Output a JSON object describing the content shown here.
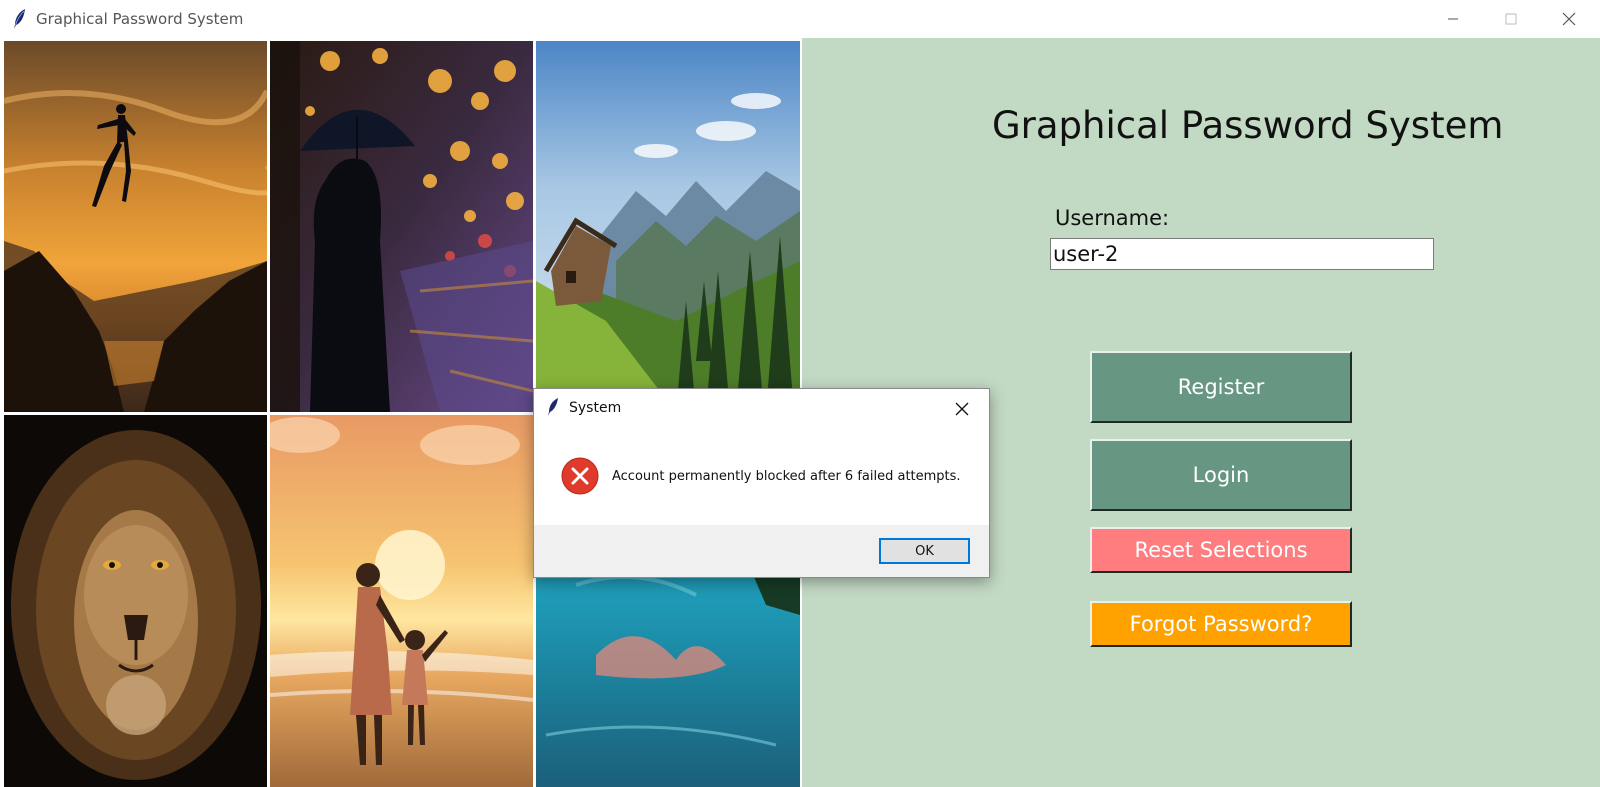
{
  "window": {
    "title": "Graphical Password System",
    "controls": [
      "minimize",
      "maximize",
      "close"
    ]
  },
  "image_grid": {
    "tiles": [
      {
        "subject": "person leaping over cliffs at sunset"
      },
      {
        "subject": "person with umbrella on rainy city street at night"
      },
      {
        "subject": "mountain cabin in alpine valley"
      },
      {
        "subject": "lion face portrait"
      },
      {
        "subject": "mother and child on beach at sunset"
      },
      {
        "subject": "turquoise lake reflecting forest"
      }
    ]
  },
  "panel": {
    "heading": "Graphical Password System",
    "username_label": "Username:",
    "username_value": "user-2",
    "buttons": {
      "register": "Register",
      "login": "Login",
      "reset": "Reset Selections",
      "forgot": "Forgot Password?"
    },
    "colors": {
      "background": "#c2d9c4",
      "primary_button": "#679683",
      "reset_button": "#ff7d7f",
      "forgot_button": "#ffa200"
    }
  },
  "dialog": {
    "title": "System",
    "icon": "error-icon",
    "message": "Account permanently blocked after 6 failed attempts.",
    "ok_label": "OK"
  }
}
